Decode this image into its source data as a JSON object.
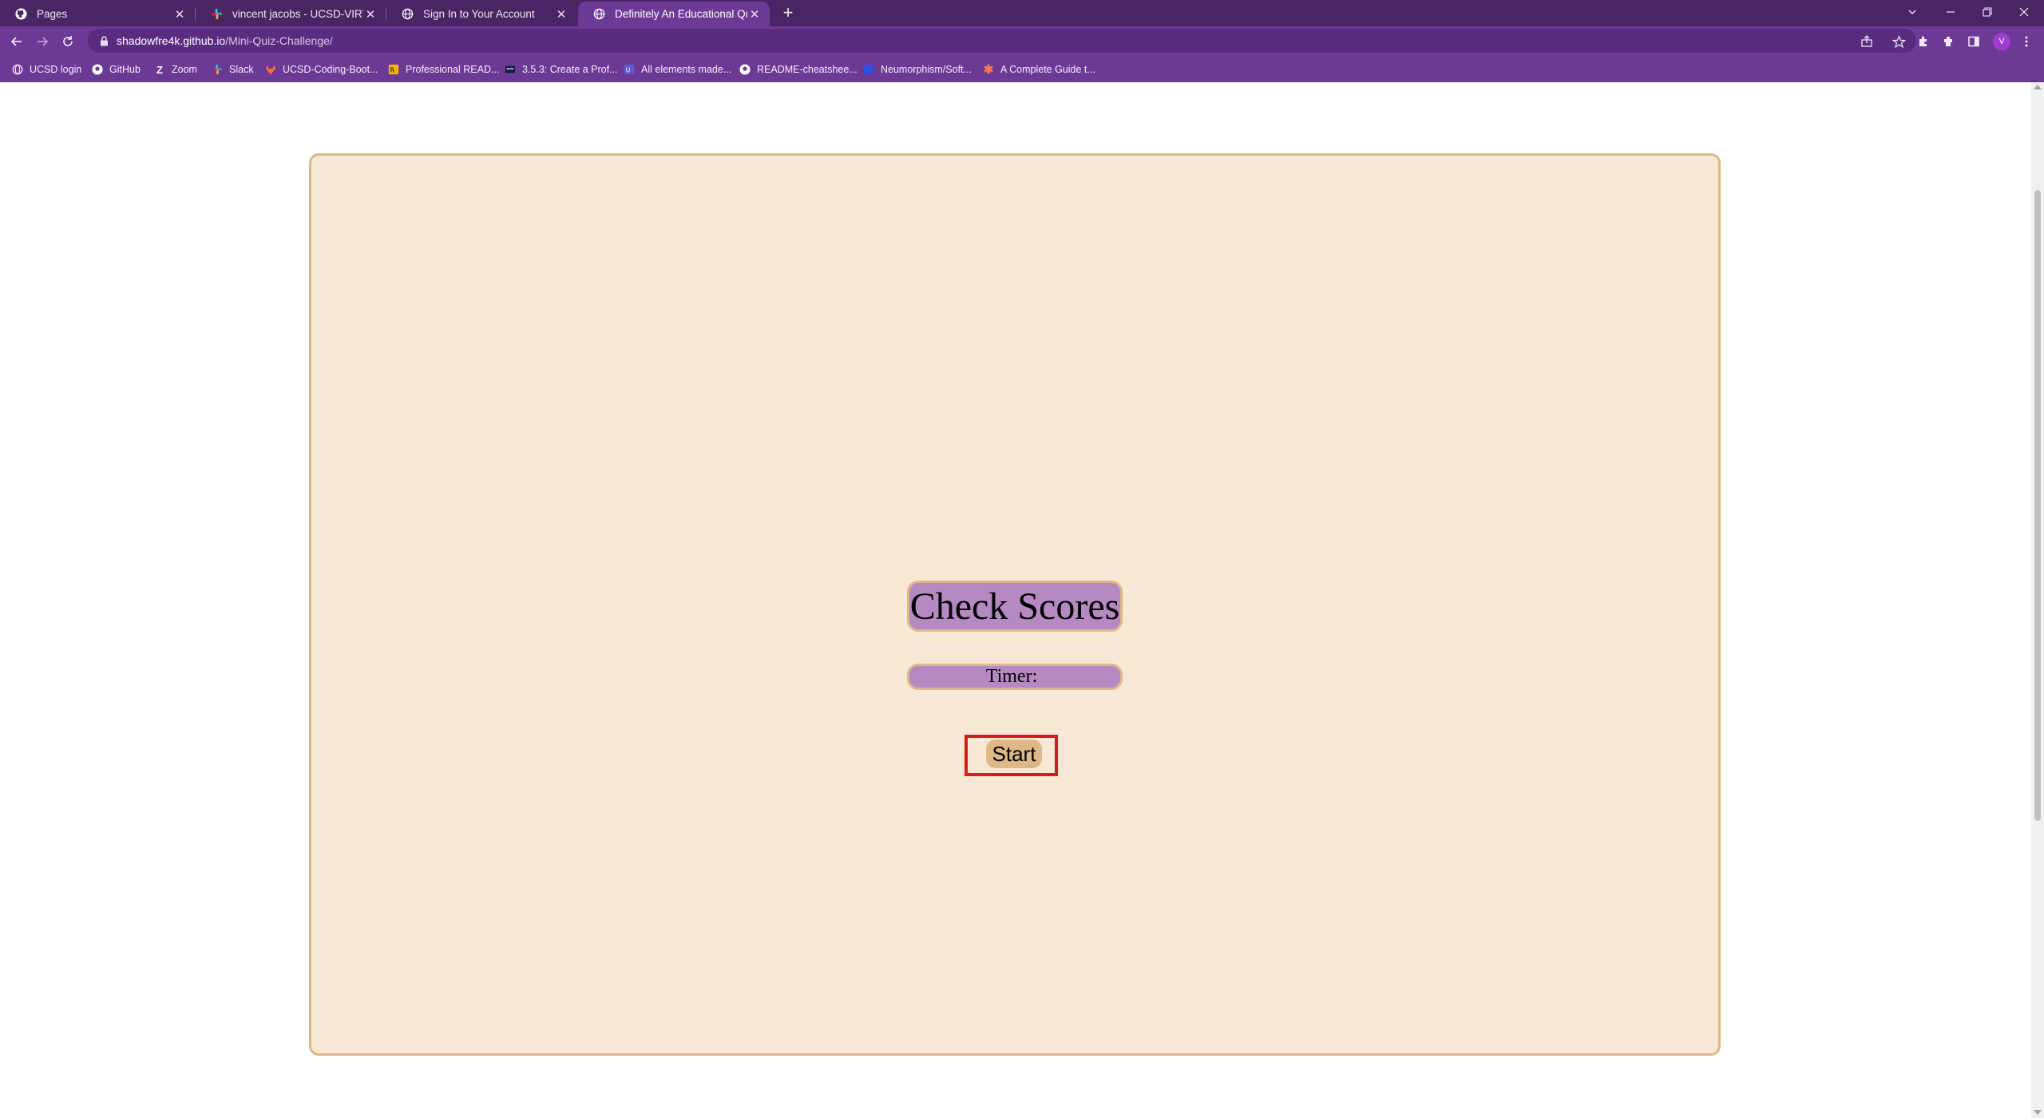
{
  "browser": {
    "tabs": [
      {
        "title": "Pages",
        "icon": "github-icon",
        "active": false
      },
      {
        "title": "vincent jacobs - UCSD-VIRT-FSF",
        "icon": "slack-icon",
        "active": false
      },
      {
        "title": "Sign In to Your Account",
        "icon": "globe-icon",
        "active": false
      },
      {
        "title": "Definitely An Educational Quiz",
        "icon": "globe-icon",
        "active": true
      }
    ],
    "address": {
      "host": "shadowfre4k.github.io",
      "path": "/Mini-Quiz-Challenge/"
    },
    "profile_initial": "V",
    "bookmarks": [
      {
        "label": "UCSD login",
        "icon": "globe-icon"
      },
      {
        "label": "GitHub",
        "icon": "github-icon"
      },
      {
        "label": "Zoom",
        "icon": "zoom-icon"
      },
      {
        "label": "Slack",
        "icon": "slack-icon"
      },
      {
        "label": "UCSD-Coding-Boot...",
        "icon": "gitlab-icon"
      },
      {
        "label": "Professional READ...",
        "icon": "readme-icon"
      },
      {
        "label": "3.5.3: Create a Prof...",
        "icon": "course-icon"
      },
      {
        "label": "All elements made...",
        "icon": "elements-icon"
      },
      {
        "label": "README-cheatshee...",
        "icon": "github-icon"
      },
      {
        "label": "Neumorphism/Soft...",
        "icon": "neumorphism-icon"
      },
      {
        "label": "A Complete Guide t...",
        "icon": "css-tricks-icon"
      }
    ]
  },
  "page": {
    "check_scores_label": "Check Scores",
    "timer_label": "Timer:",
    "timer_value": "",
    "start_label": "Start"
  },
  "colors": {
    "card_background": "#f8e9d6",
    "card_border": "#deb887",
    "button_purple": "#b589c2",
    "start_button": "#deb887",
    "focus_outline": "#d71a1a",
    "chrome_dark": "#4a2563",
    "chrome_light": "#6c3a95"
  }
}
